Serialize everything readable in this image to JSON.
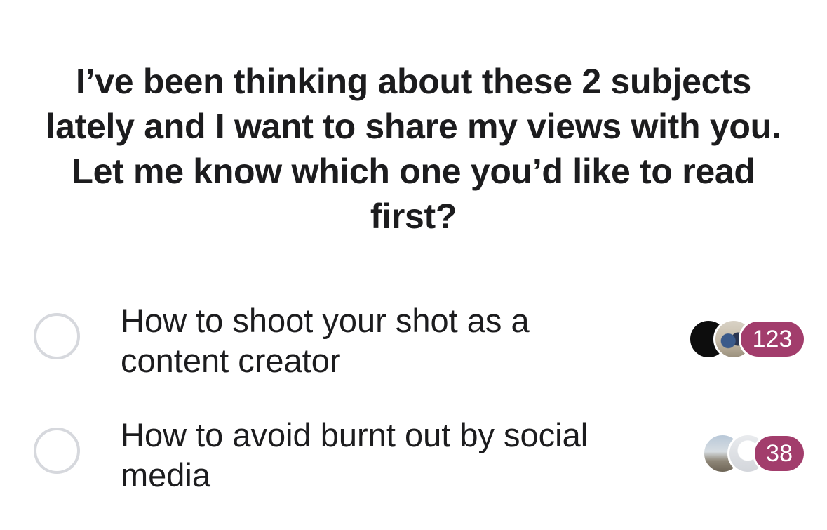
{
  "poll": {
    "question": "I’ve been thinking about these 2 subjects lately and I want to share my views with you. Let me know which one you’d like to read first?",
    "options": [
      {
        "label": "How to shoot your shot as a content creator",
        "votes": "123",
        "voter_avatars": [
          "dark-avatar",
          "photo-avatar"
        ]
      },
      {
        "label": "How to avoid burnt out by social media",
        "votes": "38",
        "voter_avatars": [
          "beach-photo-avatar",
          "blank-avatar"
        ]
      }
    ]
  },
  "colors": {
    "vote_badge": "#a23d6c",
    "radio_border": "#d6d8dd",
    "text": "#1c1c1e"
  }
}
